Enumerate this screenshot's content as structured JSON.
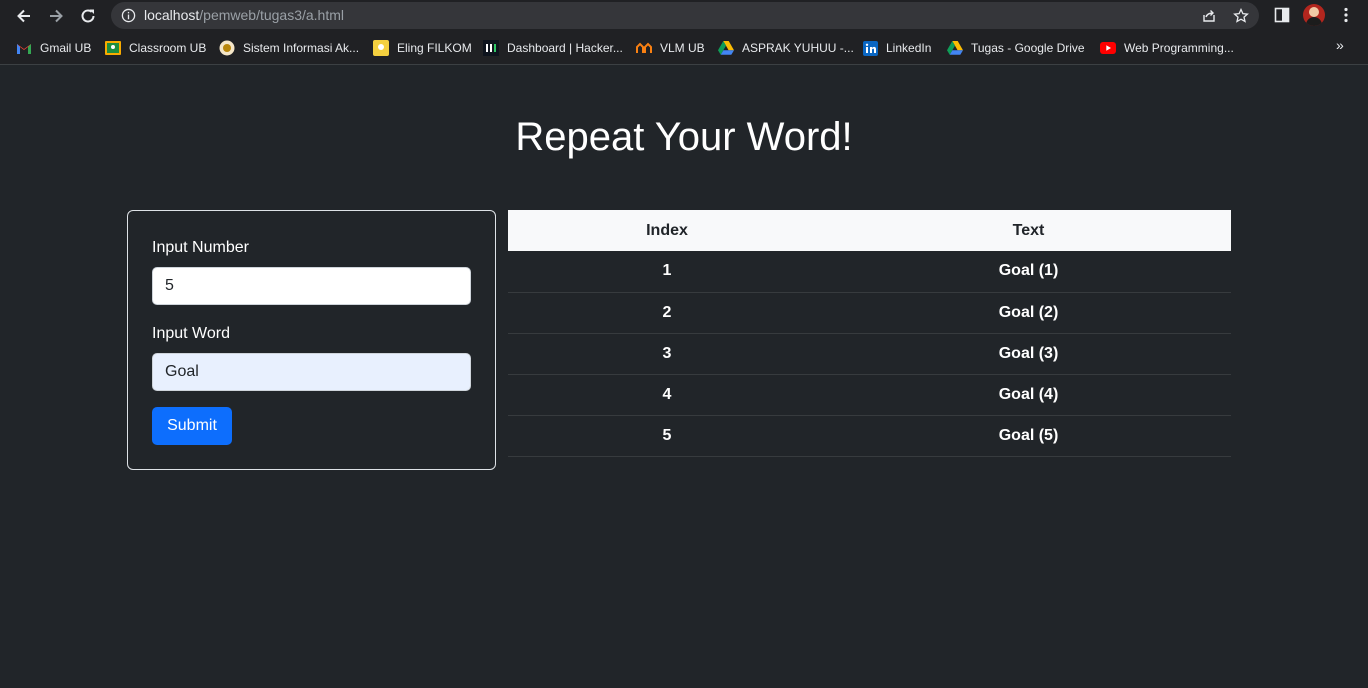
{
  "browser": {
    "url_host": "localhost",
    "url_path": "/pemweb/tugas3/a.html",
    "bookmarks": [
      {
        "label": "Gmail UB",
        "icon": "gmail-icon"
      },
      {
        "label": "Classroom UB",
        "icon": "classroom-icon"
      },
      {
        "label": "Sistem Informasi Ak...",
        "icon": "siakad-icon"
      },
      {
        "label": "Eling FILKOM",
        "icon": "eling-icon"
      },
      {
        "label": "Dashboard | Hacker...",
        "icon": "hackerrank-icon"
      },
      {
        "label": "VLM UB",
        "icon": "vlm-icon"
      },
      {
        "label": "ASPRAK YUHUU -...",
        "icon": "google-drive-icon"
      },
      {
        "label": "LinkedIn",
        "icon": "linkedin-icon"
      },
      {
        "label": "Tugas - Google Drive",
        "icon": "google-drive-icon"
      },
      {
        "label": "Web Programming...",
        "icon": "youtube-icon"
      }
    ],
    "more_label": "»"
  },
  "page": {
    "title": "Repeat Your Word!",
    "form": {
      "number_label": "Input Number",
      "number_value": "5",
      "word_label": "Input Word",
      "word_value": "Goal",
      "submit_label": "Submit"
    },
    "table": {
      "headers": [
        "Index",
        "Text"
      ],
      "rows": [
        [
          "1",
          "Goal (1)"
        ],
        [
          "2",
          "Goal (2)"
        ],
        [
          "3",
          "Goal (3)"
        ],
        [
          "4",
          "Goal (4)"
        ],
        [
          "5",
          "Goal (5)"
        ]
      ]
    }
  },
  "colors": {
    "page_bg": "#212529",
    "primary": "#0d6efd",
    "autofill_bg": "#e8f0fe"
  }
}
